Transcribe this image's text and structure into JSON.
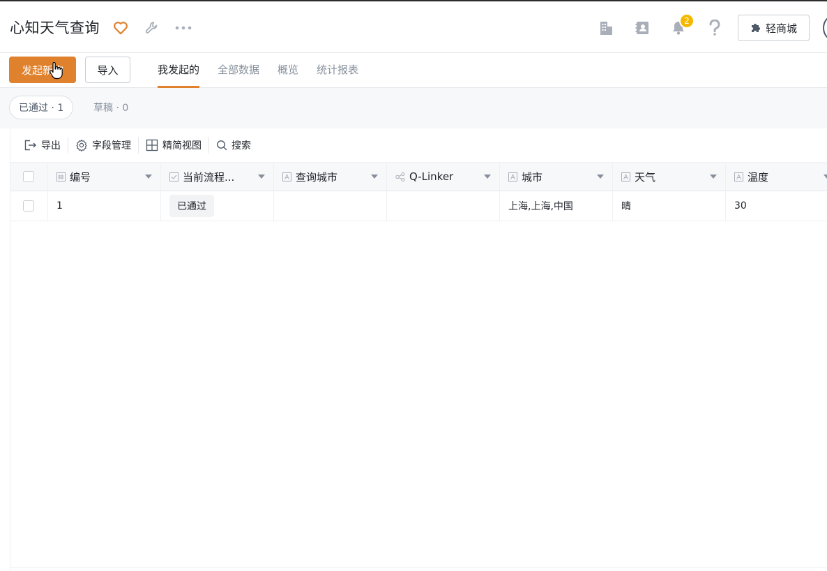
{
  "header": {
    "title": "心知天气查询",
    "notification_count": "2",
    "mall_button_label": "轻商城"
  },
  "actions": {
    "primary_label": "发起新询",
    "import_label": "导入"
  },
  "tabs": [
    {
      "label": "我发起的",
      "active": true
    },
    {
      "label": "全部数据",
      "active": false
    },
    {
      "label": "概览",
      "active": false
    },
    {
      "label": "统计报表",
      "active": false
    }
  ],
  "filters": {
    "approved": "已通过 · 1",
    "draft": "草稿 · 0"
  },
  "toolbar": {
    "export": "导出",
    "fields": "字段管理",
    "compact_view": "精简视图",
    "search": "搜索"
  },
  "table": {
    "columns": [
      {
        "label": "编号",
        "icon": "number-icon"
      },
      {
        "label": "当前流程...",
        "icon": "checkbox-field-icon"
      },
      {
        "label": "查询城市",
        "icon": "text-field-icon"
      },
      {
        "label": "Q-Linker",
        "icon": "share-icon"
      },
      {
        "label": "城市",
        "icon": "text-field-icon"
      },
      {
        "label": "天气",
        "icon": "text-field-icon"
      },
      {
        "label": "温度",
        "icon": "text-field-icon"
      }
    ],
    "rows": [
      {
        "id": "1",
        "status": "已通过",
        "query_city": "",
        "qlinker": "",
        "city": "上海,上海,中国",
        "weather": "晴",
        "temperature": "30"
      }
    ]
  },
  "colors": {
    "accent": "#e0812d",
    "badge": "#f5b800"
  }
}
